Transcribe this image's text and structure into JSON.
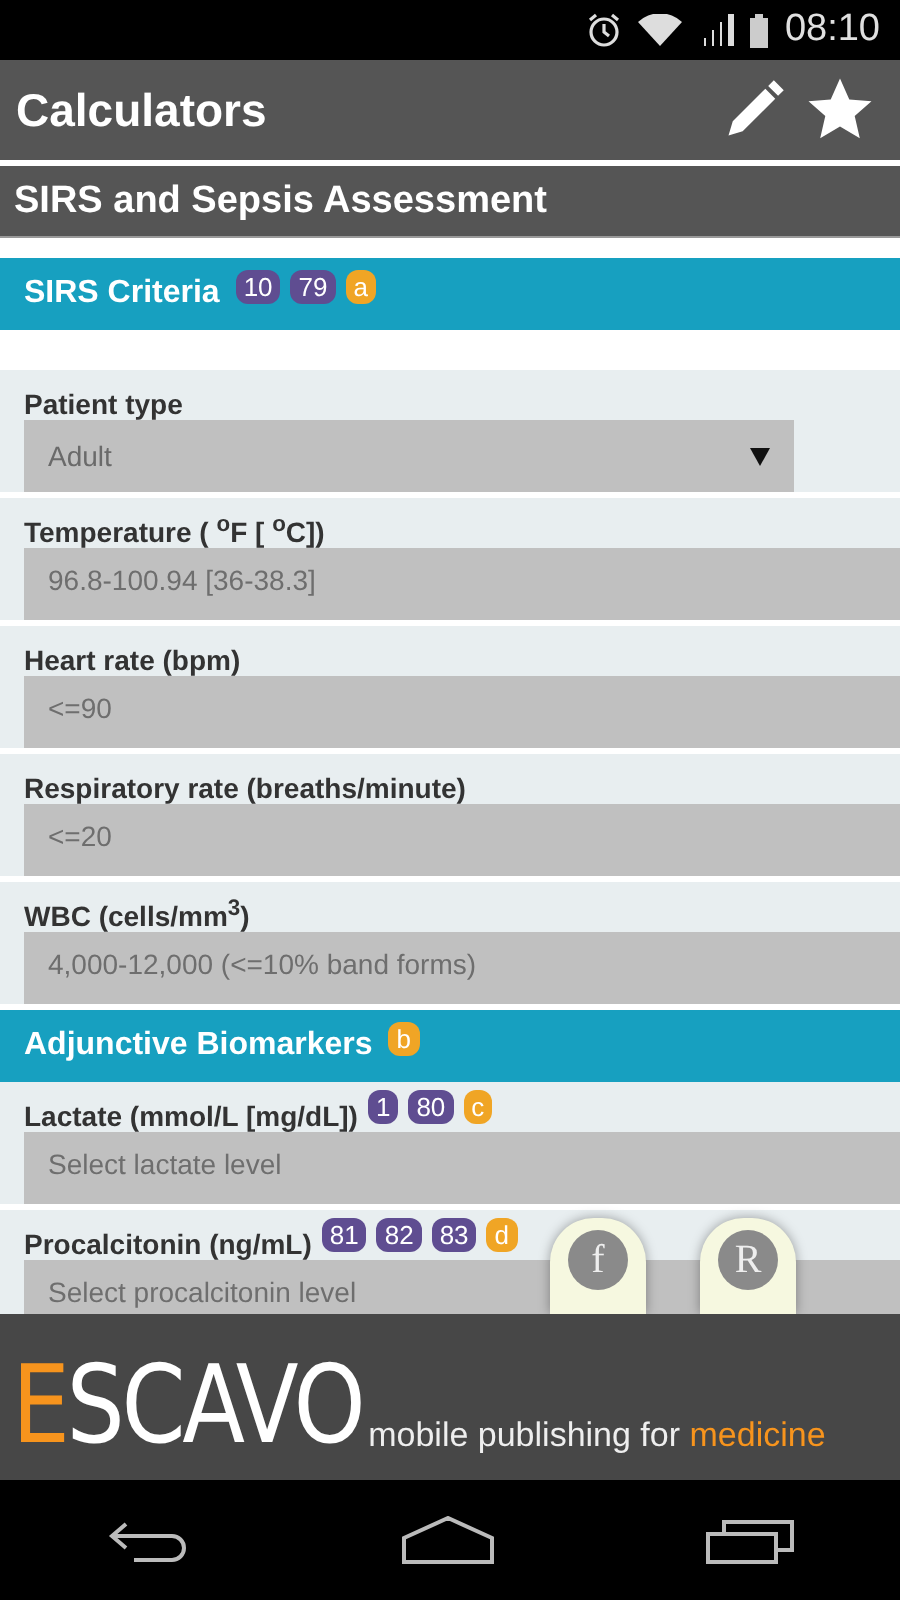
{
  "status_bar": {
    "time": "08:10"
  },
  "app_bar": {
    "title": "Calculators"
  },
  "page_title": "SIRS and Sepsis Assessment",
  "sections": [
    {
      "title": "SIRS Criteria",
      "badges": [
        {
          "text": "10",
          "kind": "ref"
        },
        {
          "text": "79",
          "kind": "ref"
        },
        {
          "text": "a",
          "kind": "note"
        }
      ],
      "fields": [
        {
          "kind": "select",
          "label": "Patient type",
          "value": "Adult"
        },
        {
          "kind": "input",
          "label": "Temperature ( $^{o}$F [ $^{o}$C])",
          "placeholder": "96.8-100.94 [36-38.3]"
        },
        {
          "kind": "input",
          "label": "Heart rate (bpm)",
          "placeholder": "<=90"
        },
        {
          "kind": "input",
          "label": "Respiratory rate (breaths/minute)",
          "placeholder": "<=20"
        },
        {
          "kind": "input",
          "label": "WBC (cells/mm$^{3}$)",
          "placeholder": "4,000-12,000 (<=10% band forms)"
        }
      ]
    },
    {
      "title": "Adjunctive Biomarkers",
      "badges": [
        {
          "text": "b",
          "kind": "note"
        }
      ],
      "fields": [
        {
          "kind": "input",
          "label": "Lactate (mmol/L [mg/dL])",
          "badges": [
            {
              "text": "1",
              "kind": "ref"
            },
            {
              "text": "80",
              "kind": "ref"
            },
            {
              "text": "c",
              "kind": "note"
            }
          ],
          "placeholder": "Select lactate level"
        },
        {
          "kind": "input",
          "label": "Procalcitonin (ng/mL)",
          "badges": [
            {
              "text": "81",
              "kind": "ref"
            },
            {
              "text": "82",
              "kind": "ref"
            },
            {
              "text": "83",
              "kind": "ref"
            },
            {
              "text": "d",
              "kind": "note"
            }
          ],
          "placeholder": "Select procalcitonin level"
        }
      ]
    }
  ],
  "side_tabs": [
    "f",
    "R"
  ],
  "footer": {
    "logo_initial": "E",
    "logo_rest": "SCAVO",
    "tagline": "mobile publishing for",
    "tagline_highlight": "medicine"
  }
}
